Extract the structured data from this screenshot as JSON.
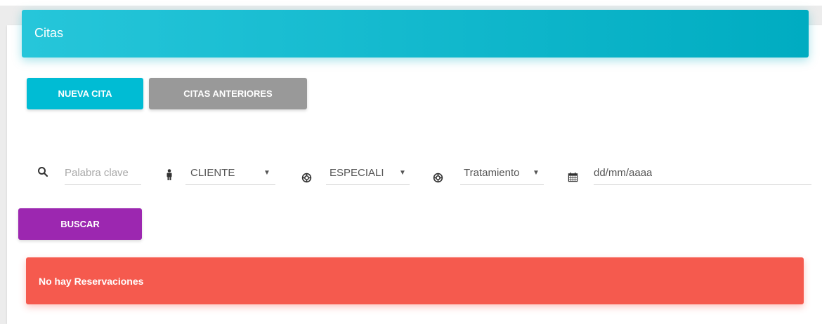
{
  "header": {
    "title": "Citas"
  },
  "actions": {
    "new_label": "NUEVA CITA",
    "previous_label": "CITAS ANTERIORES",
    "search_label": "BUSCAR"
  },
  "filters": {
    "keyword_placeholder": "Palabra clave",
    "client_value": "CLIENTE",
    "specialty_value": "ESPECIALI",
    "treatment_value": "Tratamiento",
    "date_placeholder": "dd/mm/aaaa"
  },
  "icons": {
    "search": "search-icon",
    "person": "person-icon",
    "lifebuoy": "lifebuoy-icon",
    "calendar": "calendar-icon",
    "caret": "caret-down-icon"
  },
  "alert": {
    "message": "No hay Reservaciones"
  },
  "colors": {
    "header": "#00acc1",
    "primary": "#00bcd4",
    "secondary": "#999999",
    "search": "#9c27b0",
    "danger": "#f55a4e"
  }
}
